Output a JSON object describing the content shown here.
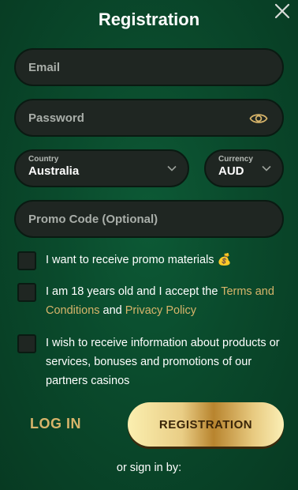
{
  "header": {
    "title": "Registration"
  },
  "form": {
    "email_placeholder": "Email",
    "password_placeholder": "Password",
    "country_label": "Country",
    "country_value": "Australia",
    "currency_label": "Currency",
    "currency_value": "AUD",
    "promo_placeholder": "Promo Code (Optional)"
  },
  "checkboxes": {
    "promo_text": "I want to receive promo materials",
    "promo_emoji": "💰",
    "age_text_1": "I am 18 years old and I accept the ",
    "terms_link": "Terms and Conditions",
    "age_and": " and ",
    "privacy_link": "Privacy Policy",
    "partners_text": "I wish to receive information about products or services, bonuses and promotions of our partners casinos"
  },
  "actions": {
    "login_label": "LOG IN",
    "register_label": "REGISTRATION",
    "signin_by": "or sign in by:"
  },
  "colors": {
    "accent_gold": "#d7b46a",
    "background_green": "#0a4a2c",
    "field_bg": "#1f2622"
  }
}
